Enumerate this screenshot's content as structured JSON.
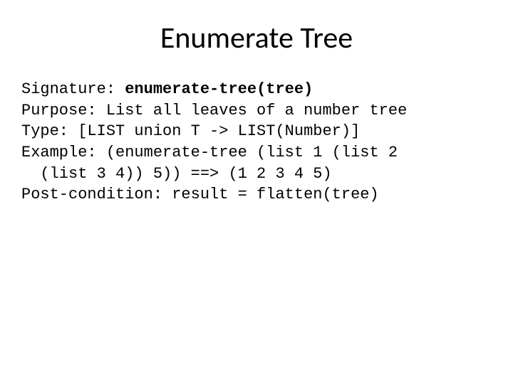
{
  "title": "Enumerate Tree",
  "lines": {
    "sig_label": "Signature: ",
    "sig_value": "enumerate-tree(tree)",
    "purpose": "Purpose: List all leaves of a number tree",
    "type": "Type: [LIST union T -> LIST(Number)]",
    "example": "Example: (enumerate-tree (list 1 (list 2\n  (list 3 4)) 5)) ==> (1 2 3 4 5)",
    "postcond": "Post-condition: result = flatten(tree)"
  }
}
